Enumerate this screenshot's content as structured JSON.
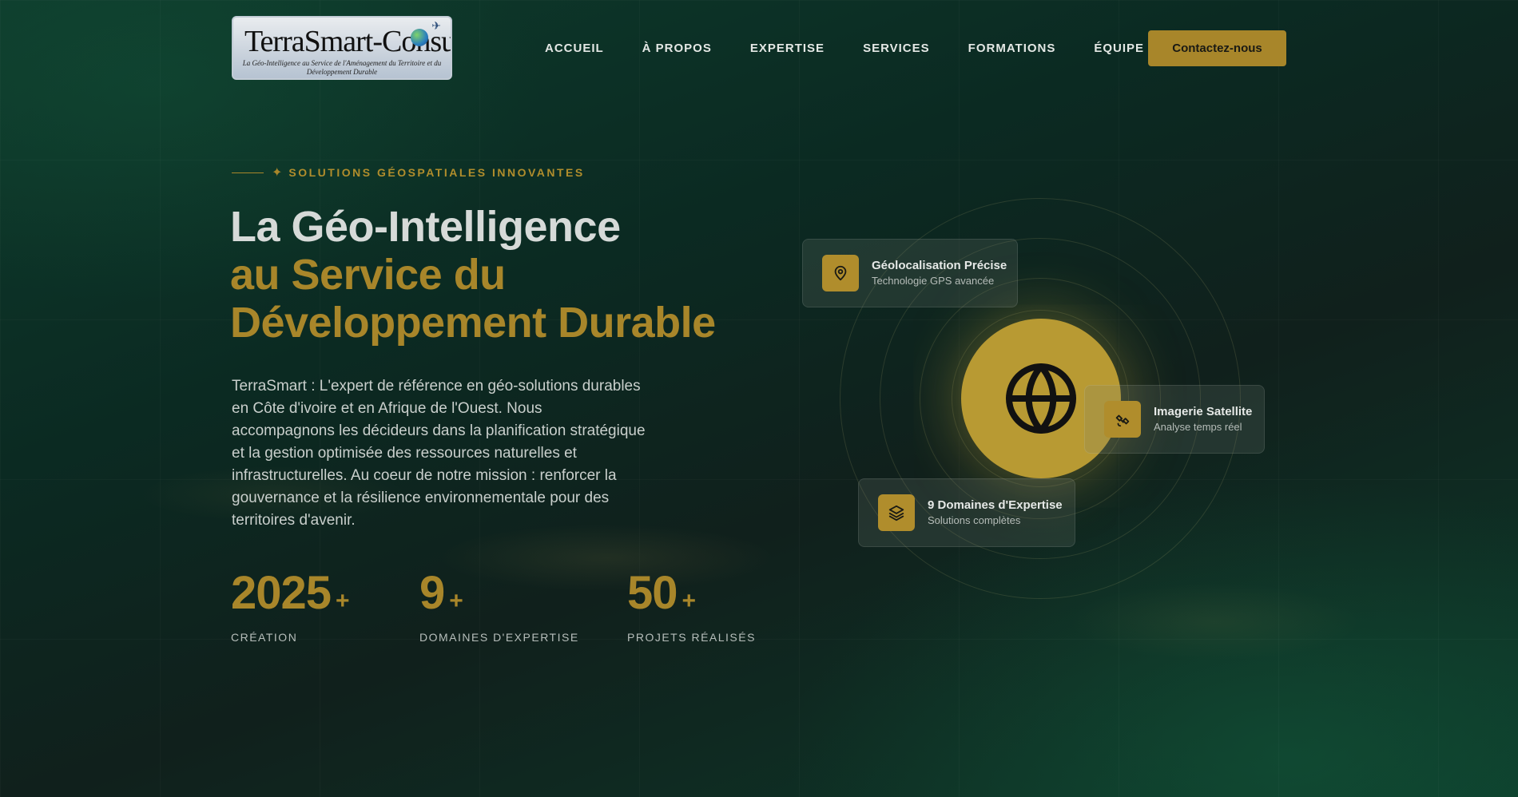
{
  "brand": {
    "logo_text_main": "TerraSmart-Consulting",
    "logo_tagline": "La Géo-Intelligence au Service de l'Aménagement du Territoire et du Développement Durable"
  },
  "nav": {
    "items": [
      {
        "label": "ACCUEIL"
      },
      {
        "label": "À PROPOS"
      },
      {
        "label": "EXPERTISE"
      },
      {
        "label": "SERVICES"
      },
      {
        "label": "FORMATIONS"
      },
      {
        "label": "ÉQUIPE"
      }
    ],
    "cta_label": "Contactez-nous"
  },
  "hero": {
    "eyebrow": "SOLUTIONS GÉOSPATIALES INNOVANTES",
    "title_line1": "La Géo-Intelligence",
    "title_line2": "au Service du",
    "title_line3": "Développement Durable",
    "description": "TerraSmart : L'expert de référence en géo-solutions durables en Côte d'ivoire et en Afrique de l'Ouest. Nous accompagnons les décideurs dans la planification stratégique et la gestion optimisée des ressources naturelles et infrastructurelles. Au coeur de notre mission : renforcer la gouvernance et la résilience environnementale pour des territoires d'avenir.",
    "stats": [
      {
        "value": "2025",
        "suffix": "+",
        "label": "CRÉATION"
      },
      {
        "value": "9",
        "suffix": "+",
        "label": "DOMAINES D'EXPERTISE"
      },
      {
        "value": "50",
        "suffix": "+",
        "label": "PROJETS RÉALISÉS"
      }
    ]
  },
  "features": [
    {
      "title": "Géolocalisation Précise",
      "subtitle": "Technologie GPS avancée",
      "icon": "map-pin-icon"
    },
    {
      "title": "Imagerie Satellite",
      "subtitle": "Analyse temps réel",
      "icon": "satellite-icon"
    },
    {
      "title": "9 Domaines d'Expertise",
      "subtitle": "Solutions complètes",
      "icon": "layers-icon"
    }
  ],
  "colors": {
    "accent": "#a8862a",
    "background": "#0e2f25"
  }
}
